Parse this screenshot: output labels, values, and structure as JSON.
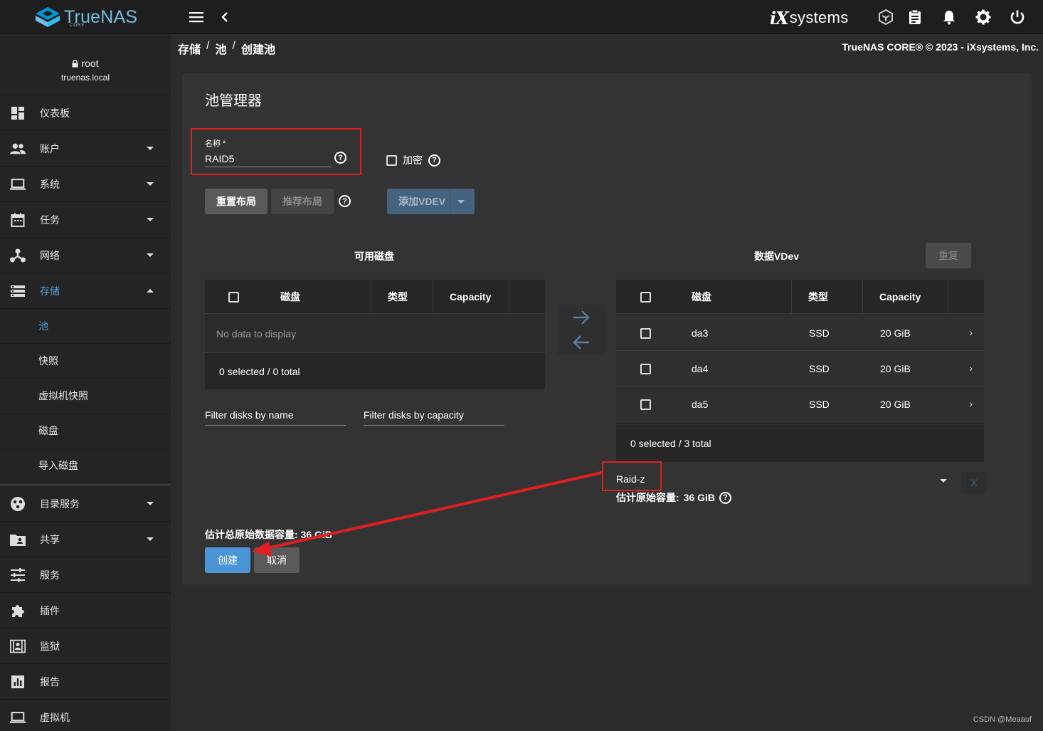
{
  "topbar": {
    "brand": "TrueNAS",
    "brand_sub": "CORE",
    "vendor_mark": "iX",
    "vendor_word": "systems"
  },
  "sidebar": {
    "user": "root",
    "host": "truenas.local",
    "items": [
      {
        "label": "仪表板",
        "icon": "dashboard-icon"
      },
      {
        "label": "账户",
        "icon": "accounts-icon"
      },
      {
        "label": "系统",
        "icon": "laptop-icon"
      },
      {
        "label": "任务",
        "icon": "calendar-icon"
      },
      {
        "label": "网络",
        "icon": "network-icon"
      },
      {
        "label": "存储",
        "icon": "storage-icon"
      }
    ],
    "storage_sub": [
      "池",
      "快照",
      "虚拟机快照",
      "磁盘",
      "导入磁盘"
    ],
    "items2": [
      {
        "label": "目录服务",
        "icon": "directory-icon"
      },
      {
        "label": "共享",
        "icon": "share-icon"
      },
      {
        "label": "服务",
        "icon": "services-icon"
      },
      {
        "label": "插件",
        "icon": "puzzle-icon"
      },
      {
        "label": "监狱",
        "icon": "jail-icon"
      },
      {
        "label": "报告",
        "icon": "chart-icon"
      },
      {
        "label": "虚拟机",
        "icon": "vm-icon"
      }
    ]
  },
  "breadcrumb": {
    "l1": "存储",
    "l2": "池",
    "l3": "创建池",
    "sep": "/"
  },
  "copyright": "TrueNAS CORE® © 2023 - iXsystems, Inc.",
  "pool": {
    "title": "池管理器",
    "name_label": "名称 *",
    "name_value": "RAID5",
    "encrypt_label": "加密",
    "reset_layout": "重置布局",
    "suggest_layout": "推荐布局",
    "add_vdev": "添加VDEV",
    "available_title": "可用磁盘",
    "data_vdev_title": "数据VDev",
    "repeat": "重复",
    "col_disk": "磁盘",
    "col_type": "类型",
    "col_capacity": "Capacity",
    "no_data": "No data to display",
    "avail_footer": "0 selected / 0 total",
    "vdev_rows": [
      {
        "disk": "da3",
        "type": "SSD",
        "capacity": "20 GiB"
      },
      {
        "disk": "da4",
        "type": "SSD",
        "capacity": "20 GiB"
      },
      {
        "disk": "da5",
        "type": "SSD",
        "capacity": "20 GiB"
      }
    ],
    "vdev_footer": "0 selected / 3 total",
    "filter_name": "Filter disks by name",
    "filter_capacity": "Filter disks by capacity",
    "raid_type": "Raid-z",
    "remove": "X",
    "est_vdev_label": "估计原始容量:",
    "est_vdev_value": "36 GiB",
    "est_total": "估计总原始数据容量: 36 GiB",
    "create": "创建",
    "cancel": "取消"
  },
  "annotation_color": "#e02020",
  "accent_color": "#4ea1e0",
  "watermark": "CSDN @Meaauf"
}
